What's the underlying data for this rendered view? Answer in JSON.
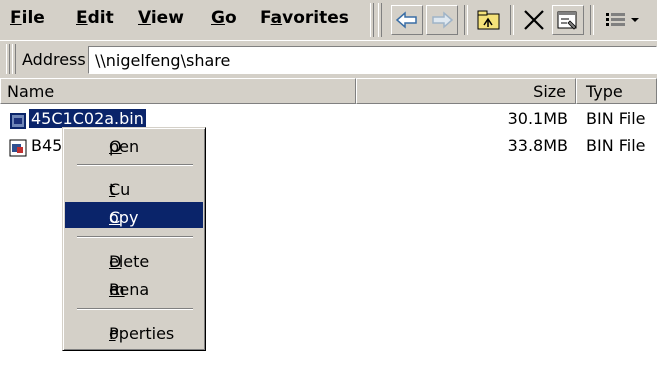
{
  "menubar": {
    "items": [
      {
        "pre": "",
        "acc": "F",
        "post": "ile"
      },
      {
        "pre": "",
        "acc": "E",
        "post": "dit"
      },
      {
        "pre": "",
        "acc": "V",
        "post": "iew"
      },
      {
        "pre": "",
        "acc": "G",
        "post": "o"
      },
      {
        "pre": "F",
        "acc": "a",
        "post": "vorites"
      }
    ]
  },
  "toolbar": {
    "icons": [
      "back-arrow-icon",
      "forward-arrow-icon",
      "up-folder-icon",
      "delete-x-icon",
      "properties-icon",
      "views-icon"
    ]
  },
  "address": {
    "label": "Address",
    "value": "\\\\nigelfeng\\share"
  },
  "list": {
    "columns": [
      "Name",
      "Size",
      "Type"
    ],
    "rows": [
      {
        "name": "45C1C02a.bin",
        "size": "30.1MB",
        "type": "BIN File",
        "selected": true
      },
      {
        "name": "B45",
        "size": "33.8MB",
        "type": "BIN File",
        "selected": false
      }
    ]
  },
  "context_menu": {
    "items": [
      {
        "pre": "",
        "acc": "O",
        "post": "pen"
      },
      {
        "pre": "Cu",
        "acc": "t",
        "post": ""
      },
      {
        "pre": "",
        "acc": "C",
        "post": "opy"
      },
      {
        "pre": "",
        "acc": "D",
        "post": "elete"
      },
      {
        "pre": "Rena",
        "acc": "m",
        "post": "e"
      },
      {
        "pre": "P",
        "acc": "r",
        "post": "operties"
      }
    ],
    "highlighted": "Copy"
  },
  "colors": {
    "face": "#d4d0c8",
    "selection": "#0a246a",
    "arrow": "#3a6ea5"
  }
}
